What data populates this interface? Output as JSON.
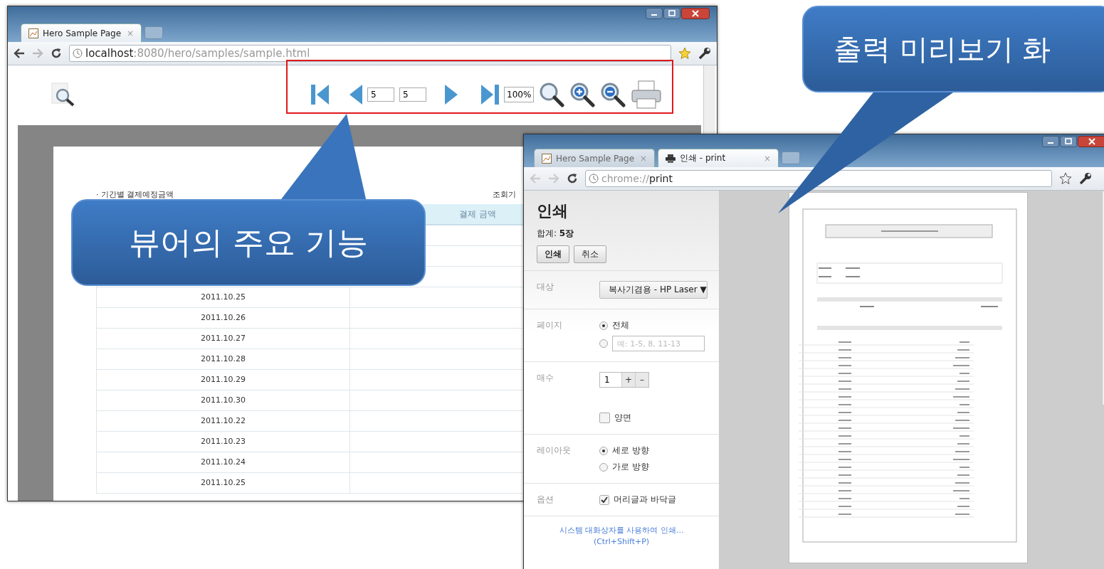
{
  "viewer_window": {
    "tab": {
      "title": "Hero Sample Page",
      "close": "×"
    },
    "url_host": "localhost",
    "url_path": ":8080/hero/samples/sample.html",
    "toolbar": {
      "page_current": "5",
      "page_total": "5",
      "zoom": "100%"
    },
    "report": {
      "title": "· 기간별 결제예정금액",
      "basis": "조회기",
      "amount_header": "결제 금액",
      "rows": [
        "2011.10.25",
        "2011.10.26",
        "2011.10.27",
        "2011.10.28",
        "2011.10.29",
        "2011.10.30",
        "2011.10.22",
        "2011.10.23",
        "2011.10.24",
        "2011.10.25"
      ]
    }
  },
  "print_window": {
    "tabs": [
      {
        "title": "Hero Sample Page",
        "close": "×",
        "selected": false
      },
      {
        "title": "인쇄 - print",
        "close": "×",
        "selected": true
      }
    ],
    "url_scheme": "chrome://",
    "url_path": "print",
    "dialog": {
      "title": "인쇄",
      "total": "합계: **5장**",
      "buttons": [
        {
          "label": "인쇄",
          "primary": true
        },
        {
          "label": "취소",
          "primary": false
        }
      ],
      "sections": [
        {
          "kind": "select",
          "label": "대상",
          "value": "복사기겸용 - HP Laser",
          "arrow": "▼"
        },
        {
          "kind": "radio",
          "label": "페이지",
          "options": [
            {
              "label": "전체",
              "selected": true
            },
            {
              "placeholder": "예: 1-5, 8, 11-13",
              "selected": false
            }
          ]
        },
        {
          "kind": "copies",
          "label": "매수",
          "value": "1",
          "plus": "+",
          "minus": "–",
          "options": [
            {
              "label": "양면",
              "checked": false
            }
          ]
        },
        {
          "kind": "radio",
          "label": "레이아웃",
          "options": [
            {
              "label": "세로 방향",
              "selected": true
            },
            {
              "label": "가로 방향",
              "selected": false
            }
          ]
        },
        {
          "kind": "checkbox",
          "label": "옵션",
          "options": [
            {
              "label": "머리글과 바닥글",
              "checked": true
            }
          ]
        }
      ],
      "system_link": "시스템 대화상자를 사용하여 인쇄...",
      "shortcut": "(Ctrl+Shift+P)"
    }
  },
  "callouts": [
    {
      "text": "뷰어의 주요 기능"
    },
    {
      "text": "출력 미리보기 화"
    }
  ]
}
